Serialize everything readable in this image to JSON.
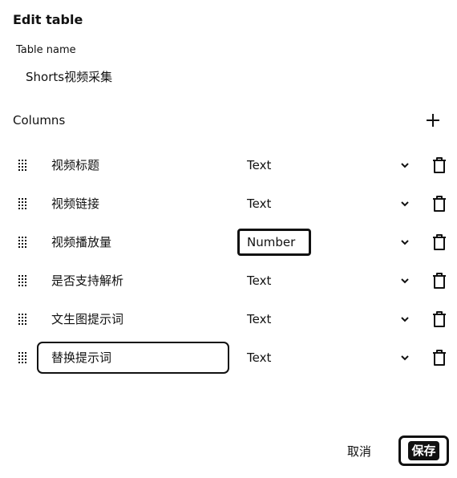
{
  "dialog": {
    "title": "Edit table",
    "table_name_label": "Table name",
    "table_name_value": "Shorts视频采集",
    "columns_label": "Columns",
    "add_icon": "plus-icon"
  },
  "columns": [
    {
      "name": "视频标题",
      "type": "Text"
    },
    {
      "name": "视频链接",
      "type": "Text"
    },
    {
      "name": "视频播放量",
      "type": "Number"
    },
    {
      "name": "是否支持解析",
      "type": "Text"
    },
    {
      "name": "文生图提示词",
      "type": "Text"
    },
    {
      "name": "替换提示词",
      "type": "Text"
    }
  ],
  "footer": {
    "cancel_label": "取消",
    "save_label": "保存"
  }
}
